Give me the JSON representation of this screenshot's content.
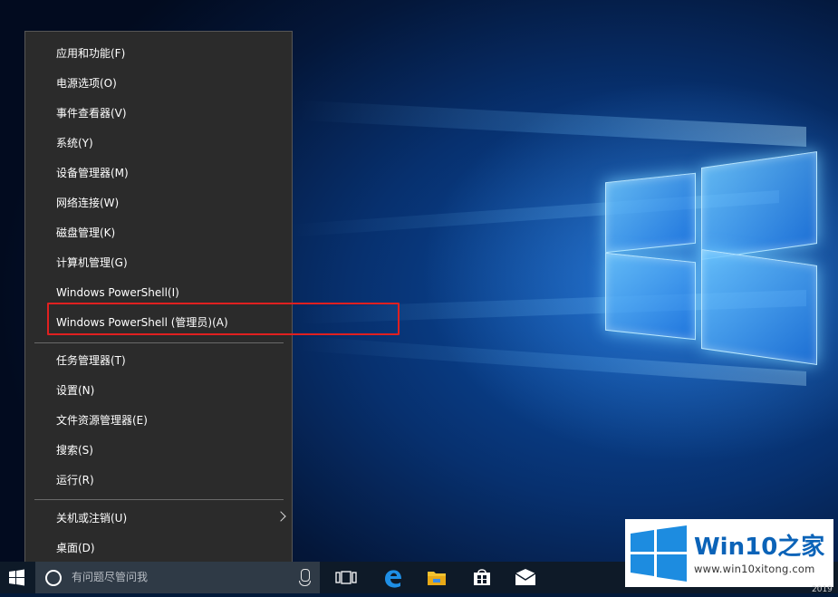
{
  "context_menu": {
    "items": [
      {
        "label": "应用和功能(F)"
      },
      {
        "label": "电源选项(O)"
      },
      {
        "label": "事件查看器(V)"
      },
      {
        "label": "系统(Y)"
      },
      {
        "label": "设备管理器(M)"
      },
      {
        "label": "网络连接(W)"
      },
      {
        "label": "磁盘管理(K)"
      },
      {
        "label": "计算机管理(G)"
      },
      {
        "label": "Windows PowerShell(I)"
      },
      {
        "label": "Windows PowerShell (管理员)(A)"
      },
      {
        "label": "任务管理器(T)"
      },
      {
        "label": "设置(N)"
      },
      {
        "label": "文件资源管理器(E)"
      },
      {
        "label": "搜索(S)"
      },
      {
        "label": "运行(R)"
      },
      {
        "label": "关机或注销(U)",
        "submenu_icon": "chevron-right-icon"
      },
      {
        "label": "桌面(D)"
      }
    ]
  },
  "taskbar": {
    "search_placeholder": "有问题尽管问我",
    "icons": [
      "windows-start-icon",
      "cortana-icon",
      "microphone-icon",
      "task-view-icon",
      "edge-icon",
      "file-explorer-icon",
      "store-icon",
      "mail-icon"
    ]
  },
  "watermark": {
    "title": "Win10之家",
    "url": "www.win10xitong.com"
  },
  "clock_fragment": "2019",
  "colors": {
    "menu_bg": "#2b2b2b",
    "highlight": "#e02020",
    "taskbar": "#0e1a28",
    "accent": "#0b63b8"
  }
}
